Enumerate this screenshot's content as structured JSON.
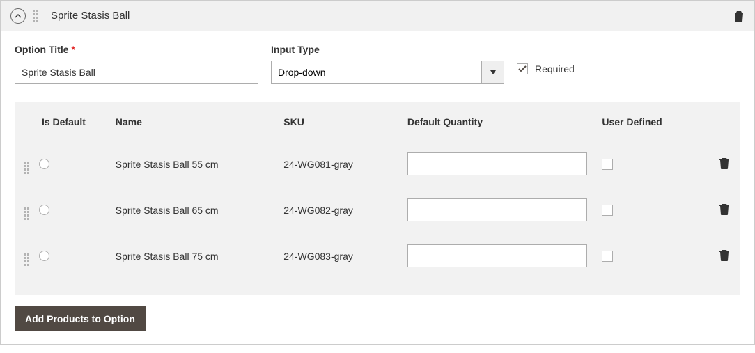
{
  "header": {
    "title": "Sprite Stasis Ball"
  },
  "form": {
    "option_title_label": "Option Title",
    "option_title_value": "Sprite Stasis Ball",
    "input_type_label": "Input Type",
    "input_type_value": "Drop-down",
    "required_label": "Required",
    "required_checked": true
  },
  "grid": {
    "headers": {
      "is_default": "Is Default",
      "name": "Name",
      "sku": "SKU",
      "default_qty": "Default Quantity",
      "user_defined": "User Defined"
    },
    "rows": [
      {
        "name": "Sprite Stasis Ball 55 cm",
        "sku": "24-WG081-gray",
        "qty": "",
        "user_defined": false,
        "is_default": false
      },
      {
        "name": "Sprite Stasis Ball 65 cm",
        "sku": "24-WG082-gray",
        "qty": "",
        "user_defined": false,
        "is_default": false
      },
      {
        "name": "Sprite Stasis Ball 75 cm",
        "sku": "24-WG083-gray",
        "qty": "",
        "user_defined": false,
        "is_default": false
      }
    ]
  },
  "footer": {
    "add_products_label": "Add Products to Option"
  }
}
